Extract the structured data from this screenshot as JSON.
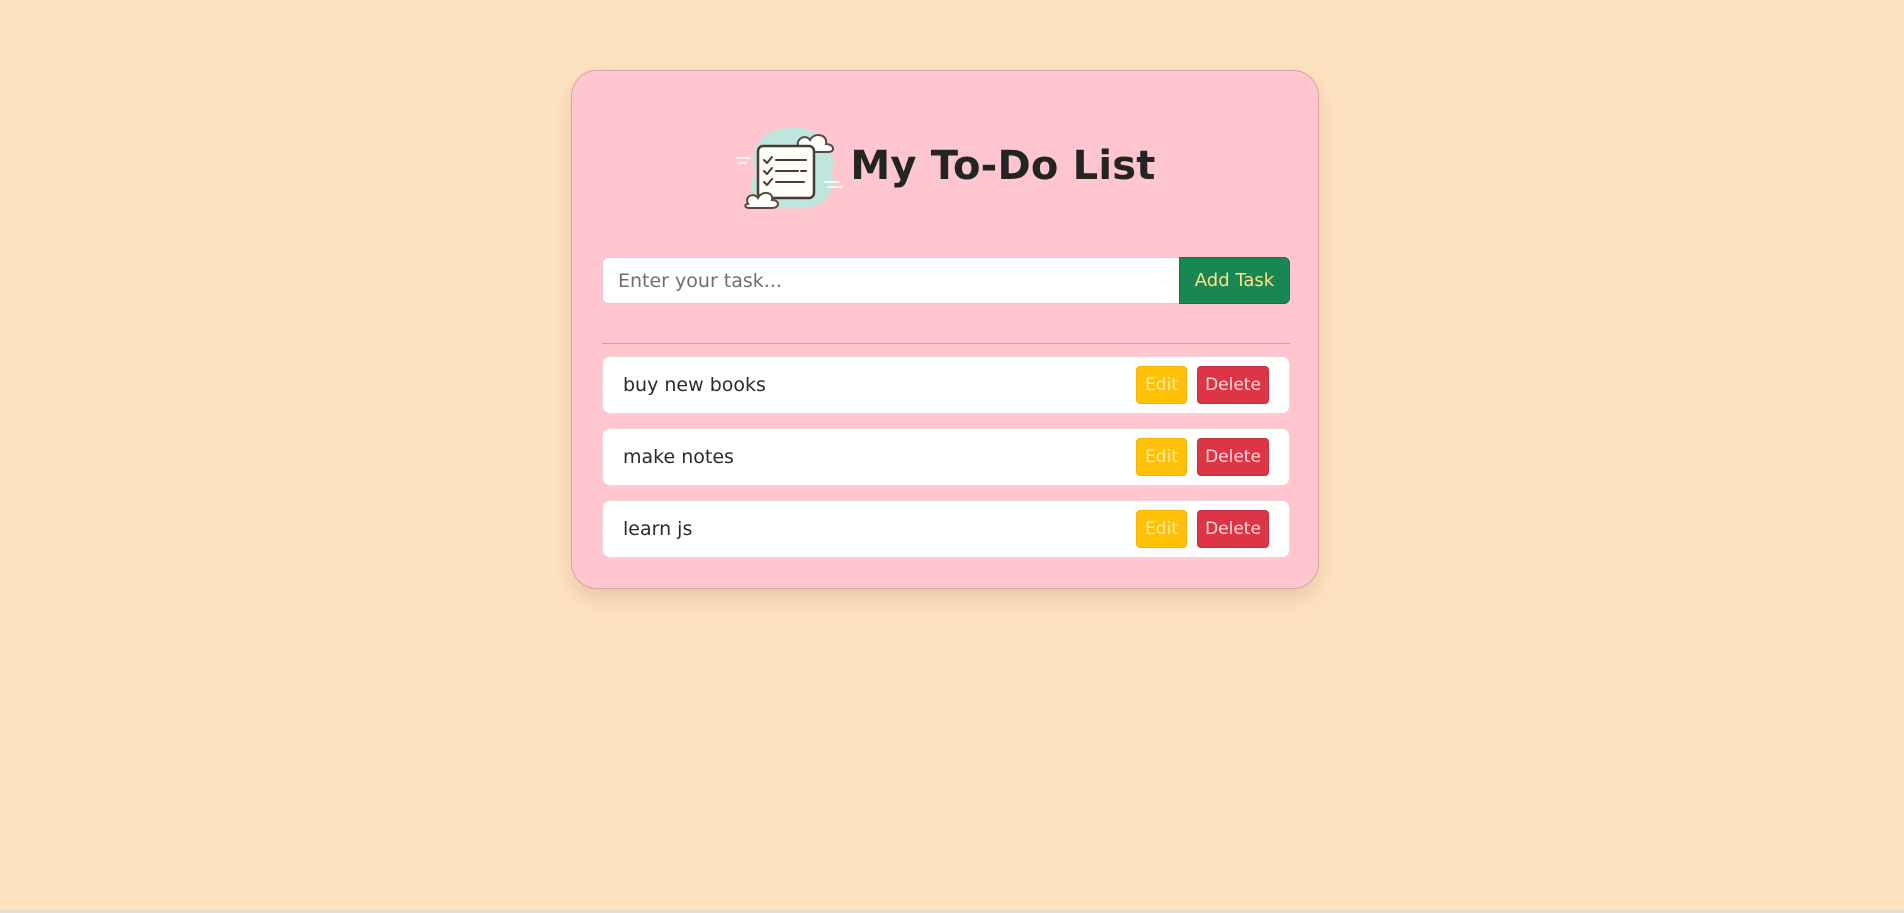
{
  "app": {
    "title": "My To-Do List",
    "logo_icon": "checklist-clouds-icon"
  },
  "input": {
    "placeholder": "Enter your task...",
    "value": ""
  },
  "add_button": {
    "label": "Add Task"
  },
  "tasks": [
    {
      "text": "buy new books",
      "edit_label": "Edit",
      "delete_label": "Delete"
    },
    {
      "text": "make notes",
      "edit_label": "Edit",
      "delete_label": "Delete"
    },
    {
      "text": "learn js",
      "edit_label": "Edit",
      "delete_label": "Delete"
    }
  ],
  "colors": {
    "page_background": "#ffe3c0",
    "card_background": "#ffc6d0",
    "add_button": "#198754",
    "edit_button": "#ffc107",
    "delete_button": "#dc3545"
  }
}
